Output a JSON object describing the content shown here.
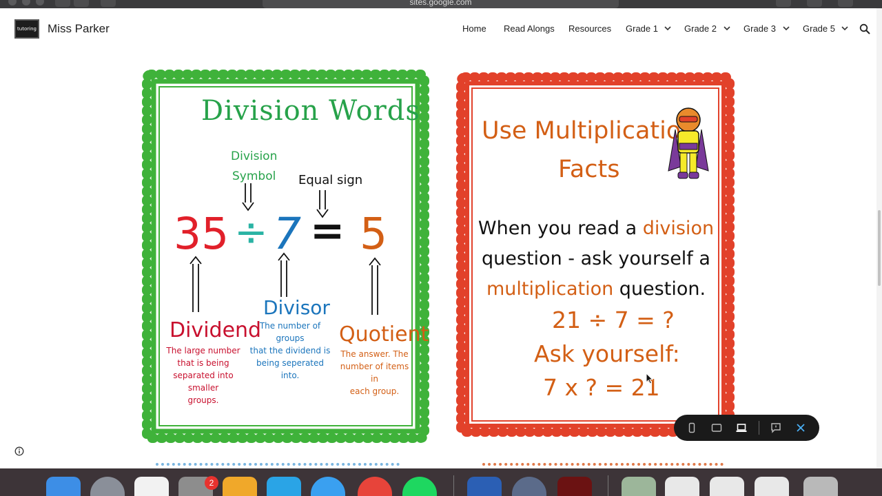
{
  "browser": {
    "url": "sites.google.com"
  },
  "site": {
    "logo_text": "tutoring",
    "title": "Miss Parker",
    "nav": [
      {
        "label": "Home"
      },
      {
        "label": "Read Alongs"
      },
      {
        "label": "Resources"
      },
      {
        "label": "Grade 1"
      },
      {
        "label": "Grade 2"
      },
      {
        "label": "Grade 3"
      },
      {
        "label": "Grade 5"
      }
    ]
  },
  "division_words": {
    "title": "Division Words",
    "division_symbol_label": "Division\nSymbol",
    "equal_sign_label": "Equal sign",
    "dividend_value": "35",
    "division_sign": "÷",
    "divisor_value": "7",
    "equals": "=",
    "quotient_value": "5",
    "dividend_label": "Dividend",
    "dividend_desc": "The large number\nthat is being\nseparated into smaller\ngroups.",
    "divisor_label": "Divisor",
    "divisor_desc": "The number of groups\nthat the dividend is\nbeing seperated into.",
    "quotient_label": "Quotient",
    "quotient_desc": "The answer. The\nnumber of items in\neach group."
  },
  "multiplication_facts": {
    "title": "Use Multiplication\nFacts",
    "body_1": "When you read a ",
    "body_division": "division",
    "body_2": " question - ask yourself a ",
    "body_multiplication": "multiplication",
    "body_3": " question.",
    "example": "21 ÷ 7 = ?",
    "ask": "Ask yourself:",
    "answer_prompt": "7 x ? = 21"
  },
  "dock": {
    "badge_count": "2"
  },
  "colors": {
    "green": "#27a24a",
    "red": "#e1202a",
    "blue": "#1b75bc",
    "orange": "#d35f15"
  }
}
